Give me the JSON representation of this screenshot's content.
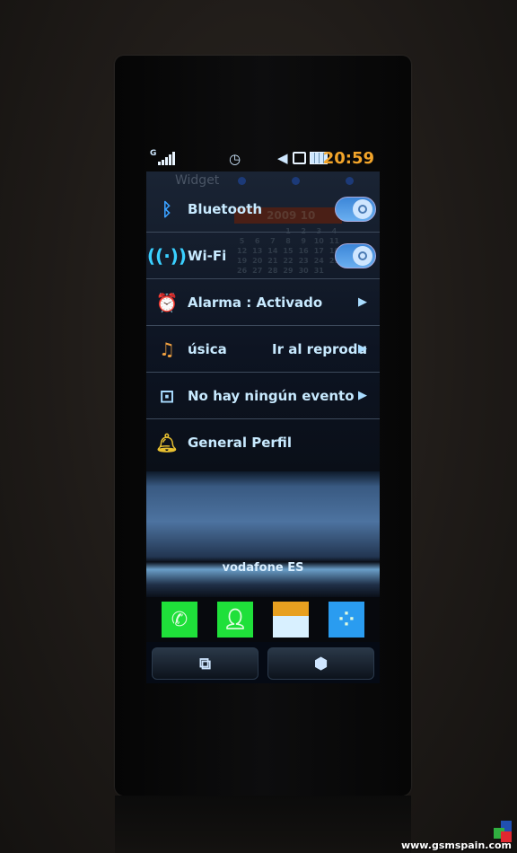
{
  "status_bar": {
    "network": "G",
    "signal_level": 5,
    "time": "20:59",
    "time_color": "#f3a52a"
  },
  "background_widget": {
    "title": "Widget",
    "year": "2009",
    "month": "10",
    "days": [
      "1",
      "2",
      "3",
      "4",
      "5",
      "6",
      "7",
      "8",
      "9",
      "10",
      "11",
      "12",
      "13",
      "14",
      "15",
      "16",
      "17",
      "18",
      "19",
      "20",
      "21",
      "22",
      "23",
      "24",
      "25",
      "26",
      "27",
      "28",
      "29",
      "30",
      "31"
    ]
  },
  "quick_panel": {
    "items": [
      {
        "icon": "bluetooth-icon",
        "label": "Bluetooth",
        "toggle": true
      },
      {
        "icon": "wifi-icon",
        "label": "Wi-Fi",
        "toggle": true
      },
      {
        "icon": "alarm-clock-icon",
        "label": "Alarma : Activado"
      },
      {
        "icon": "music-note-icon",
        "label": "úsica",
        "action": "Ir al reprodu"
      },
      {
        "icon": "exclamation-icon",
        "label": "No hay ningún evento"
      },
      {
        "icon": "bell-icon",
        "label": "General Perfil"
      }
    ]
  },
  "operator": "vodafone ES",
  "dock": [
    {
      "icon": "phone-icon",
      "color": "#1fe03a"
    },
    {
      "icon": "contacts-icon",
      "color": "#1fe03a"
    },
    {
      "icon": "message-icon",
      "color": "#e8a020"
    },
    {
      "icon": "menu-grid-icon",
      "color": "#2a9cf0"
    }
  ],
  "bottom_buttons": [
    {
      "icon": "multitask-icon"
    },
    {
      "icon": "cube-icon"
    }
  ],
  "watermark": "www.gsmspain.com"
}
